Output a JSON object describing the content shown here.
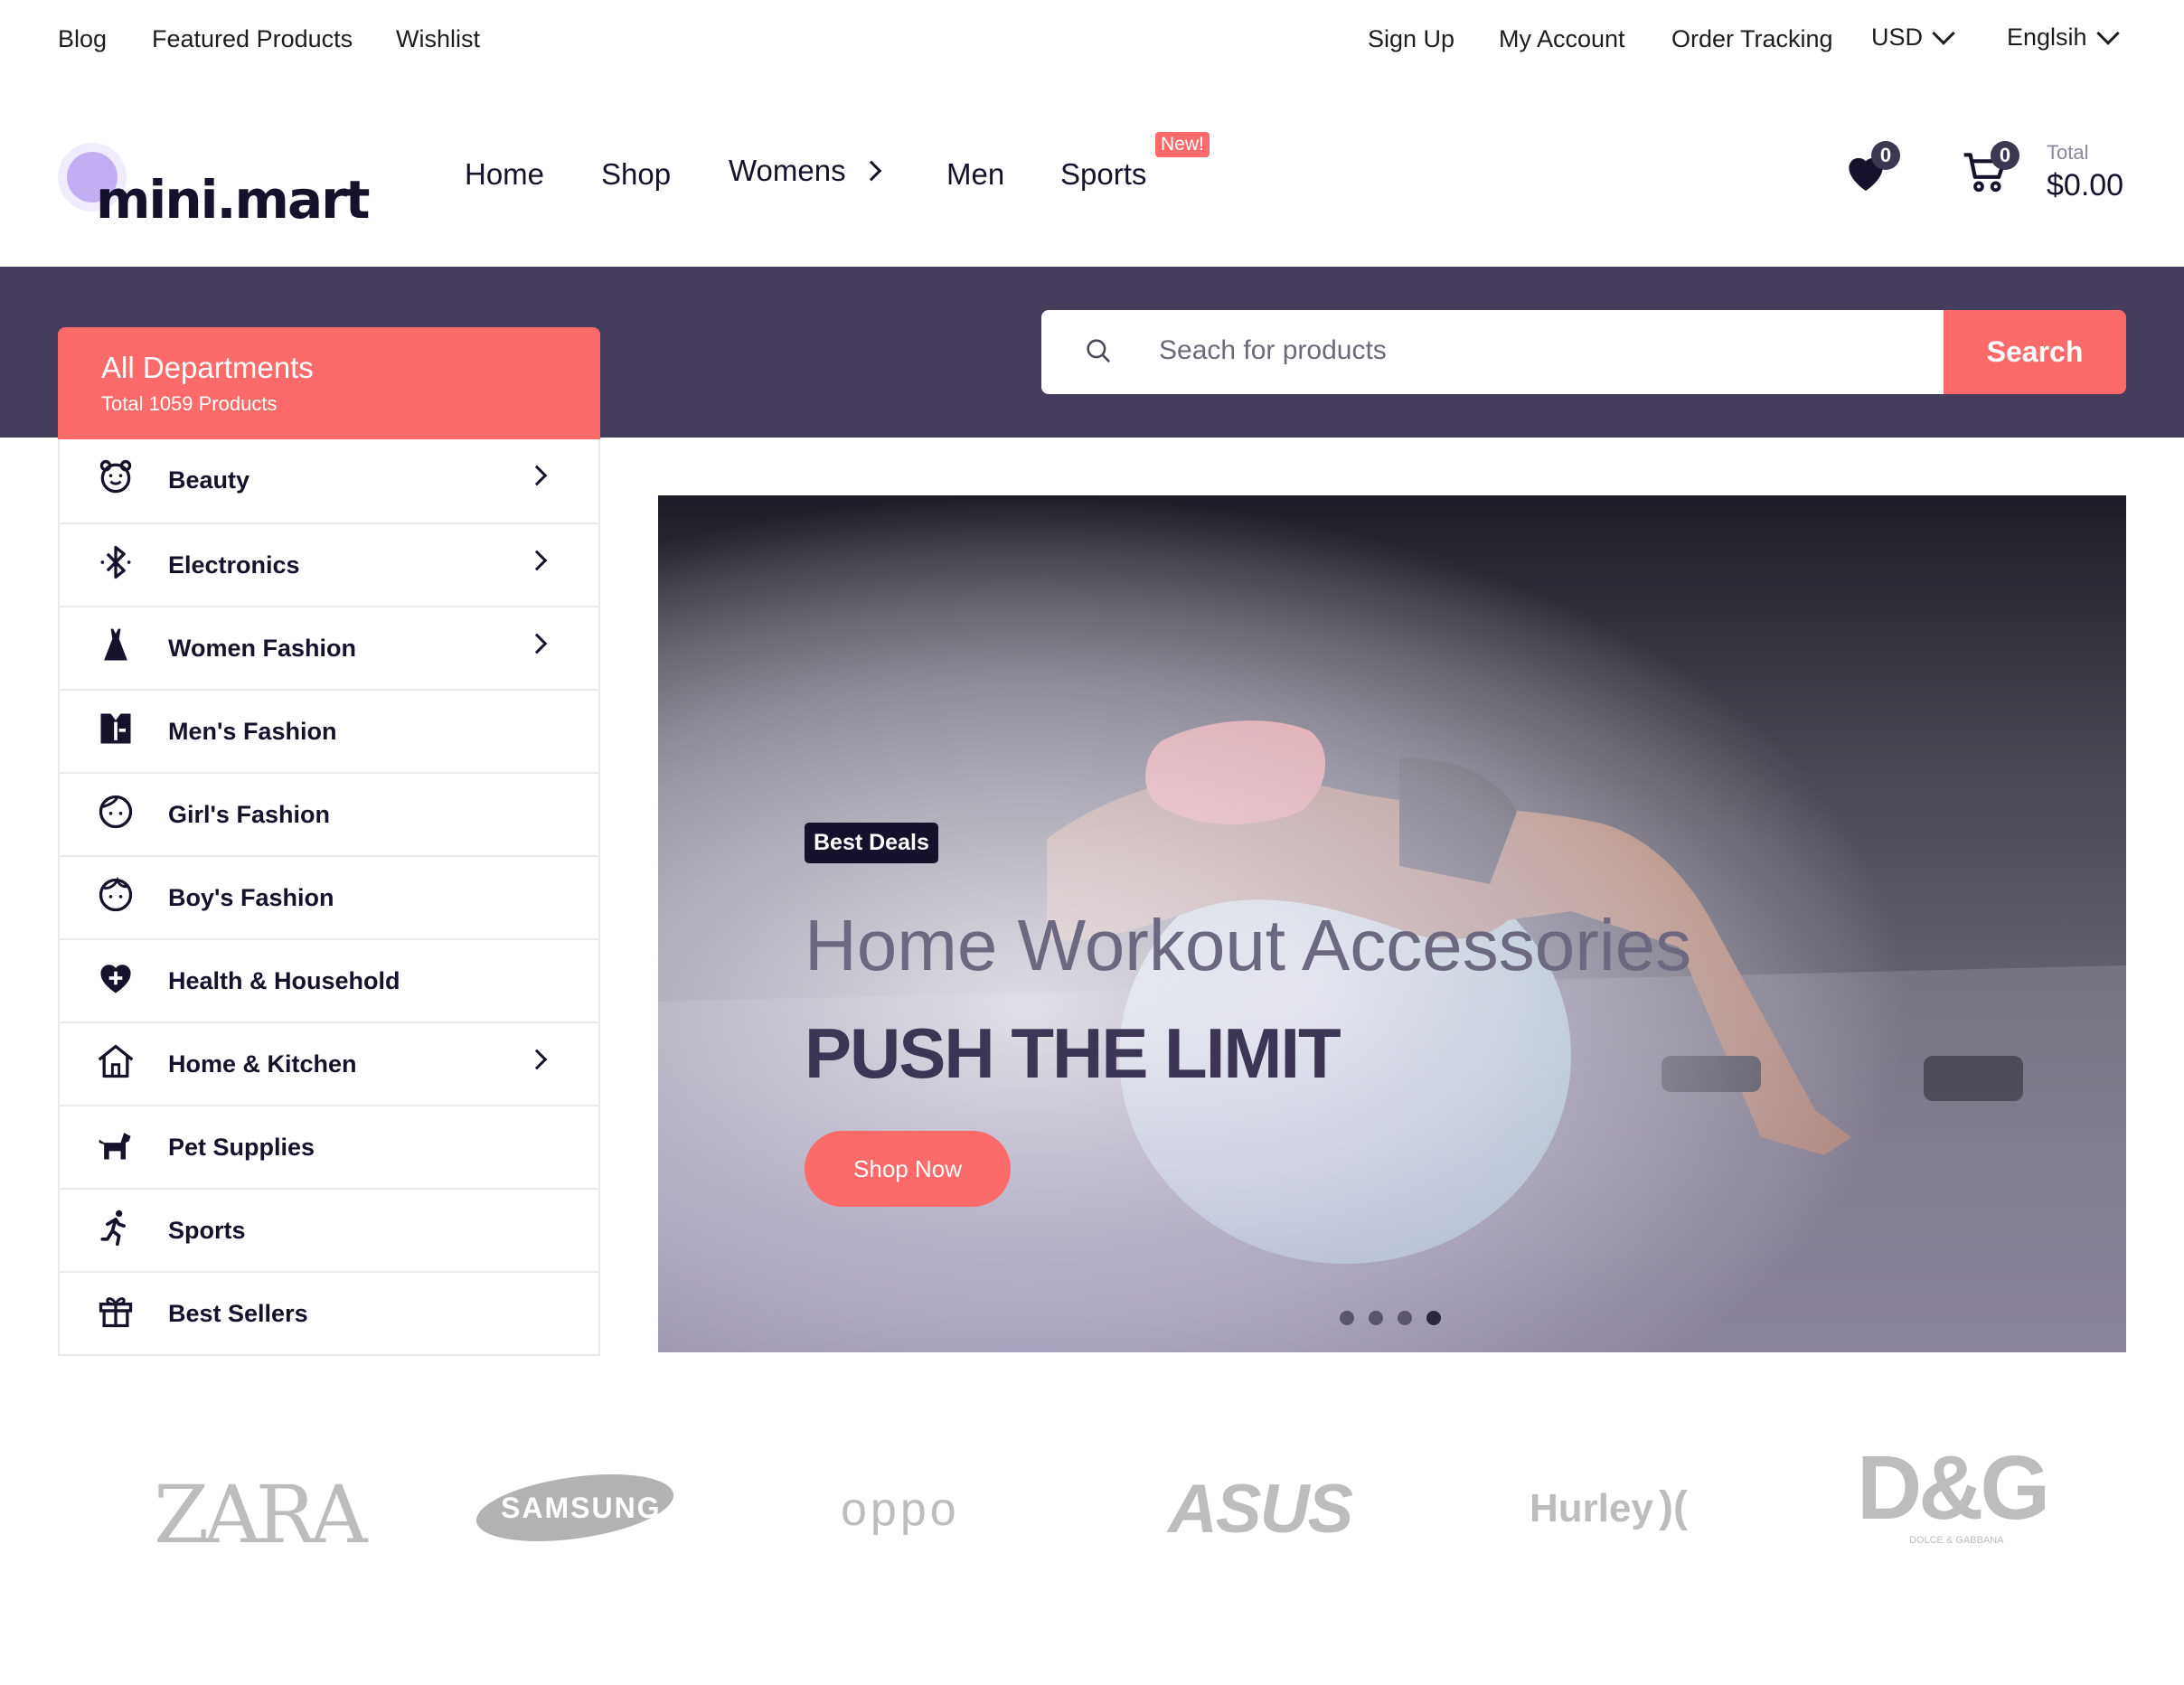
{
  "topbar": {
    "left_links": [
      "Blog",
      "Featured Products",
      "Wishlist"
    ],
    "right_links": [
      "Sign Up",
      "My Account",
      "Order Tracking"
    ],
    "currency": "USD",
    "language": "Englsih"
  },
  "header": {
    "logo": "mini.mart",
    "nav": [
      "Home",
      "Shop",
      "Womens",
      "Men",
      "Sports"
    ],
    "new_badge": "New!",
    "wishlist_count": "0",
    "cart_count": "0",
    "total_label": "Total",
    "total_value": "$0.00"
  },
  "search": {
    "placeholder": "Seach for products",
    "button": "Search"
  },
  "departments": {
    "title": "All Departments",
    "subtitle": "Total 1059 Products",
    "items": [
      {
        "label": "Beauty",
        "icon": "bear-face-icon",
        "arrow": true
      },
      {
        "label": "Electronics",
        "icon": "bluetooth-icon",
        "arrow": true
      },
      {
        "label": "Women Fashion",
        "icon": "dress-icon",
        "arrow": true
      },
      {
        "label": "Men's Fashion",
        "icon": "suit-icon",
        "arrow": false
      },
      {
        "label": "Girl's Fashion",
        "icon": "girl-face-icon",
        "arrow": false
      },
      {
        "label": "Boy's Fashion",
        "icon": "boy-face-icon",
        "arrow": false
      },
      {
        "label": "Health & Household",
        "icon": "health-heart-icon",
        "arrow": false
      },
      {
        "label": "Home & Kitchen",
        "icon": "house-icon",
        "arrow": true
      },
      {
        "label": "Pet Supplies",
        "icon": "dog-icon",
        "arrow": false
      },
      {
        "label": "Sports",
        "icon": "runner-icon",
        "arrow": false
      },
      {
        "label": "Best Sellers",
        "icon": "gift-icon",
        "arrow": false
      }
    ]
  },
  "hero": {
    "badge": "Best Deals",
    "title": "Home Workout Accessories",
    "subtitle": "PUSH THE LIMIT",
    "button": "Shop Now",
    "slides": 4,
    "active_slide": 4
  },
  "brands": [
    "ZARA",
    "SAMSUNG",
    "oppo",
    "ASUS",
    "Hurley",
    "D&G",
    "DOLCE & GABBANA"
  ],
  "colors": {
    "accent": "#fd6a6a",
    "band": "#463c5e",
    "dark": "#15122b"
  }
}
